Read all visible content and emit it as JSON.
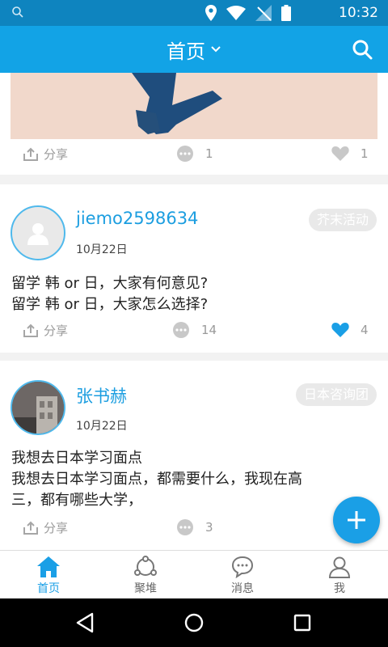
{
  "status_bar": {
    "time": "10:32"
  },
  "app_bar": {
    "title": "首页"
  },
  "posts": [
    {
      "share_label": "分享",
      "comments": "1",
      "likes": "1"
    },
    {
      "username": "jiemo2598634",
      "date": "10月22日",
      "tag": "芥末活动",
      "lines": [
        "留学 韩 or 日，大家有何意见?",
        "留学 韩 or 日，大家怎么选择?"
      ],
      "share_label": "分享",
      "comments": "14",
      "likes": "4",
      "liked": true
    },
    {
      "username": "张书赫",
      "date": "10月22日",
      "tag": "日本咨询团",
      "lines": [
        "我想去日本学习面点",
        "我想去日本学习面点，都需要什么，我现在高",
        "三，都有哪些大学，"
      ],
      "share_label": "分享",
      "comments": "3"
    }
  ],
  "tabs": [
    {
      "label": "首页",
      "icon": "home-icon",
      "active": true
    },
    {
      "label": "聚堆",
      "icon": "group-icon"
    },
    {
      "label": "消息",
      "icon": "message-icon"
    },
    {
      "label": "我",
      "icon": "person-icon"
    }
  ],
  "colors": {
    "primary": "#12a3e6",
    "status_bar": "#0e84bf",
    "accent": "#1a9fe6",
    "like_active": "#1a9fe6"
  }
}
